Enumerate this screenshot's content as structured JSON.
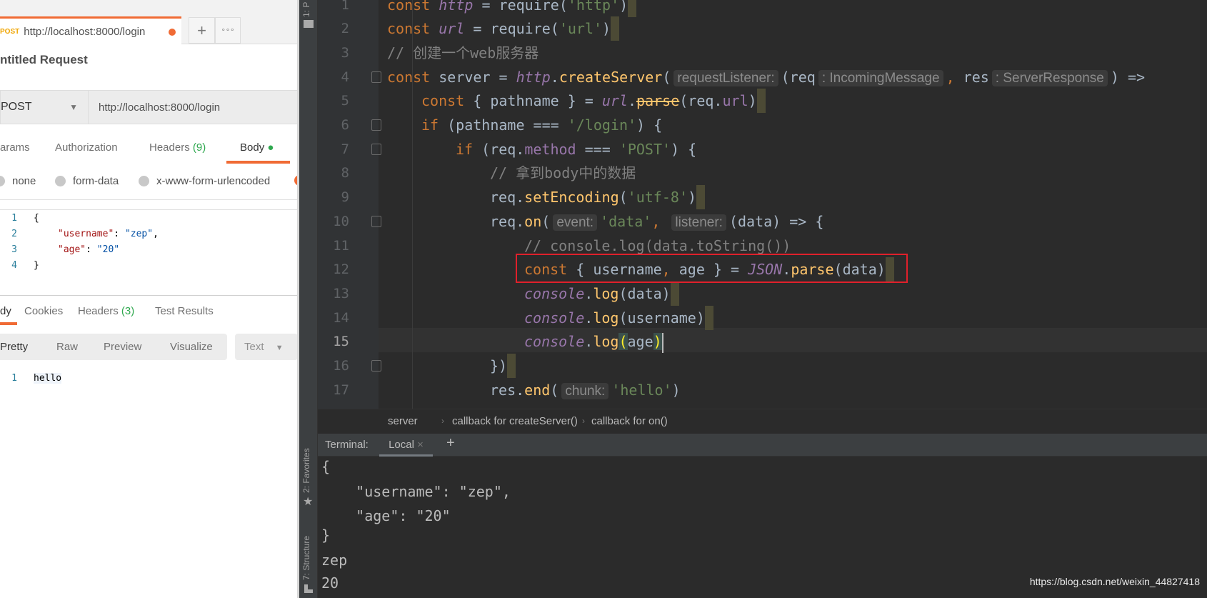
{
  "postman": {
    "tab": {
      "method": "POST",
      "url": "http://localhost:8000/login"
    },
    "new_tab": "+",
    "more_tabs": "∘∘∘",
    "request_title": "ntitled Request",
    "method": "POST",
    "url": "http://localhost:8000/login",
    "req_tabs": {
      "params": "arams",
      "authorization": "Authorization",
      "headers": "Headers",
      "headers_count": "(9)",
      "body": "Body"
    },
    "body_types": [
      "none",
      "form-data",
      "x-www-form-urlencoded"
    ],
    "body_lines": [
      {
        "n": "1",
        "text": "{"
      },
      {
        "n": "2",
        "key": "\"username\"",
        "sep": ": ",
        "val": "\"zep\"",
        "end": ","
      },
      {
        "n": "3",
        "key": "\"age\"",
        "sep": ": ",
        "val": "\"20\"",
        "end": ""
      },
      {
        "n": "4",
        "text": "}"
      }
    ],
    "resp_tabs": {
      "body": "dy",
      "cookies": "Cookies",
      "headers": "Headers",
      "headers_count": "(3)",
      "tests": "Test Results"
    },
    "view_modes": [
      "Pretty",
      "Raw",
      "Preview",
      "Visualize"
    ],
    "format": "Text",
    "response_lines": [
      {
        "n": "1",
        "text": "hello"
      }
    ]
  },
  "ide": {
    "side_tools": {
      "project": "1: P",
      "favorites": "2: Favorites",
      "structure": "7: Structure"
    },
    "code": [
      {
        "n": "1",
        "indent": 0,
        "t": [
          [
            "const ",
            "kw"
          ],
          [
            "http",
            "pur"
          ],
          [
            " = require(",
            "def"
          ],
          [
            "'http'",
            "str"
          ],
          [
            ")",
            "def"
          ]
        ],
        "box": true
      },
      {
        "n": "2",
        "indent": 0,
        "t": [
          [
            "const ",
            "kw"
          ],
          [
            "url",
            "pur"
          ],
          [
            " = require(",
            "def"
          ],
          [
            "'url'",
            "str"
          ],
          [
            ")",
            "def"
          ]
        ],
        "box": true
      },
      {
        "n": "3",
        "indent": 0,
        "t": [
          [
            "// 创建一个web服务器",
            "com"
          ]
        ]
      },
      {
        "n": "4",
        "indent": 0,
        "fold": true,
        "t": [
          [
            "const ",
            "kw"
          ],
          [
            "server = ",
            "def"
          ],
          [
            "http",
            "pur"
          ],
          [
            ".",
            "def"
          ],
          [
            "createServer",
            "fn"
          ],
          [
            "(",
            "def"
          ],
          [
            "requestListener:",
            "hint"
          ],
          [
            "(req",
            "def"
          ],
          [
            ": IncomingMessage",
            "hint"
          ],
          [
            ",",
            "kw"
          ],
          [
            " res",
            "def"
          ],
          [
            ": ServerResponse",
            "hint"
          ],
          [
            ") =>",
            "def"
          ]
        ]
      },
      {
        "n": "5",
        "indent": 1,
        "t": [
          [
            "const ",
            "kw"
          ],
          [
            "{ pathname } = ",
            "def"
          ],
          [
            "url",
            "pur"
          ],
          [
            ".",
            "def"
          ],
          [
            "parse",
            "strike"
          ],
          [
            "(req.",
            "def"
          ],
          [
            "url",
            "prop"
          ],
          [
            ")",
            "def"
          ]
        ],
        "box": true
      },
      {
        "n": "6",
        "indent": 1,
        "fold": true,
        "t": [
          [
            "if ",
            "kw"
          ],
          [
            "(pathname === ",
            "def"
          ],
          [
            "'/login'",
            "str"
          ],
          [
            ") {",
            "def"
          ]
        ]
      },
      {
        "n": "7",
        "indent": 2,
        "fold": true,
        "t": [
          [
            "if ",
            "kw"
          ],
          [
            "(req.",
            "def"
          ],
          [
            "method",
            "prop"
          ],
          [
            " === ",
            "def"
          ],
          [
            "'POST'",
            "str"
          ],
          [
            ") {",
            "def"
          ]
        ]
      },
      {
        "n": "8",
        "indent": 3,
        "t": [
          [
            "// 拿到body中的数据",
            "com"
          ]
        ]
      },
      {
        "n": "9",
        "indent": 3,
        "t": [
          [
            "req.",
            "def"
          ],
          [
            "setEncoding",
            "fn"
          ],
          [
            "(",
            "def"
          ],
          [
            "'utf-8'",
            "str"
          ],
          [
            ")",
            "def"
          ]
        ],
        "box": true
      },
      {
        "n": "10",
        "indent": 3,
        "fold": true,
        "t": [
          [
            "req.",
            "def"
          ],
          [
            "on",
            "fn"
          ],
          [
            "(",
            "def"
          ],
          [
            "event:",
            "hint"
          ],
          [
            "'data'",
            "str"
          ],
          [
            ",",
            "kw"
          ],
          [
            " ",
            "def"
          ],
          [
            "listener:",
            "hint"
          ],
          [
            "(data) => {",
            "def"
          ]
        ]
      },
      {
        "n": "11",
        "indent": 4,
        "t": [
          [
            "// console.log(data.toString())",
            "com"
          ]
        ]
      },
      {
        "n": "12",
        "indent": 4,
        "t": [
          [
            "const ",
            "kw"
          ],
          [
            "{ username",
            "def"
          ],
          [
            ",",
            "kw"
          ],
          [
            " age } = ",
            "def"
          ],
          [
            "JSON",
            "pur"
          ],
          [
            ".",
            "def"
          ],
          [
            "parse",
            "fn"
          ],
          [
            "(data)",
            "def"
          ]
        ],
        "box": true
      },
      {
        "n": "13",
        "indent": 4,
        "t": [
          [
            "console",
            "pur"
          ],
          [
            ".",
            "def"
          ],
          [
            "log",
            "fn"
          ],
          [
            "(data)",
            "def"
          ]
        ],
        "box": true
      },
      {
        "n": "14",
        "indent": 4,
        "t": [
          [
            "console",
            "pur"
          ],
          [
            ".",
            "def"
          ],
          [
            "log",
            "fn"
          ],
          [
            "(username)",
            "def"
          ]
        ],
        "box": true
      },
      {
        "n": "15",
        "indent": 4,
        "current": true,
        "t": [
          [
            "console",
            "pur"
          ],
          [
            ".",
            "def"
          ],
          [
            "log",
            "fn"
          ],
          [
            "(",
            "brk"
          ],
          [
            "age",
            "def"
          ],
          [
            ")",
            "brk"
          ]
        ],
        "cursor": true
      },
      {
        "n": "16",
        "indent": 3,
        "fold": true,
        "t": [
          [
            "})",
            "def"
          ]
        ],
        "box": true
      },
      {
        "n": "17",
        "indent": 3,
        "t": [
          [
            "res.",
            "def"
          ],
          [
            "end",
            "fn"
          ],
          [
            "(",
            "def"
          ],
          [
            "chunk:",
            "hint"
          ],
          [
            "'hello'",
            "str"
          ],
          [
            ")",
            "def"
          ]
        ]
      }
    ],
    "breadcrumbs": [
      "server",
      "callback for createServer()",
      "callback for on()"
    ],
    "breadcrumb_sep": "›",
    "terminal": {
      "label": "Terminal:",
      "tab": "Local",
      "close": "×",
      "add": "+",
      "output": [
        "{",
        "    \"username\": \"zep\",",
        "    \"age\": \"20\"",
        "}",
        "zep",
        "20"
      ]
    }
  },
  "watermark": "https://blog.csdn.net/weixin_44827418",
  "colors": {
    "postman_accent": "#f06b35",
    "keyword": "#cc7832",
    "string": "#6a8759",
    "highlight_box": "#e0202b"
  }
}
